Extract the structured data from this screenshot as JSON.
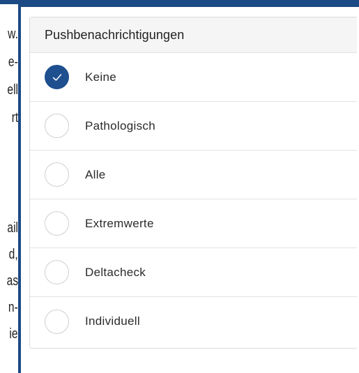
{
  "background_text": {
    "lines": [
      "w.",
      "e-",
      "ell",
      "rt",
      "ail",
      "d,",
      "as",
      "n-",
      "ie"
    ]
  },
  "notifications": {
    "title": "Pushbenachrichtigungen",
    "options": [
      {
        "label": "Keine",
        "selected": true
      },
      {
        "label": "Pathologisch",
        "selected": false
      },
      {
        "label": "Alle",
        "selected": false
      },
      {
        "label": "Extremwerte",
        "selected": false
      },
      {
        "label": "Deltacheck",
        "selected": false
      },
      {
        "label": "Individuell",
        "selected": false
      }
    ]
  },
  "colors": {
    "frame": "#1c4a84",
    "selected_radio": "#1e4f8f"
  },
  "icons": {
    "selected": "checkmark-icon",
    "unselected": "radio-empty-icon"
  }
}
